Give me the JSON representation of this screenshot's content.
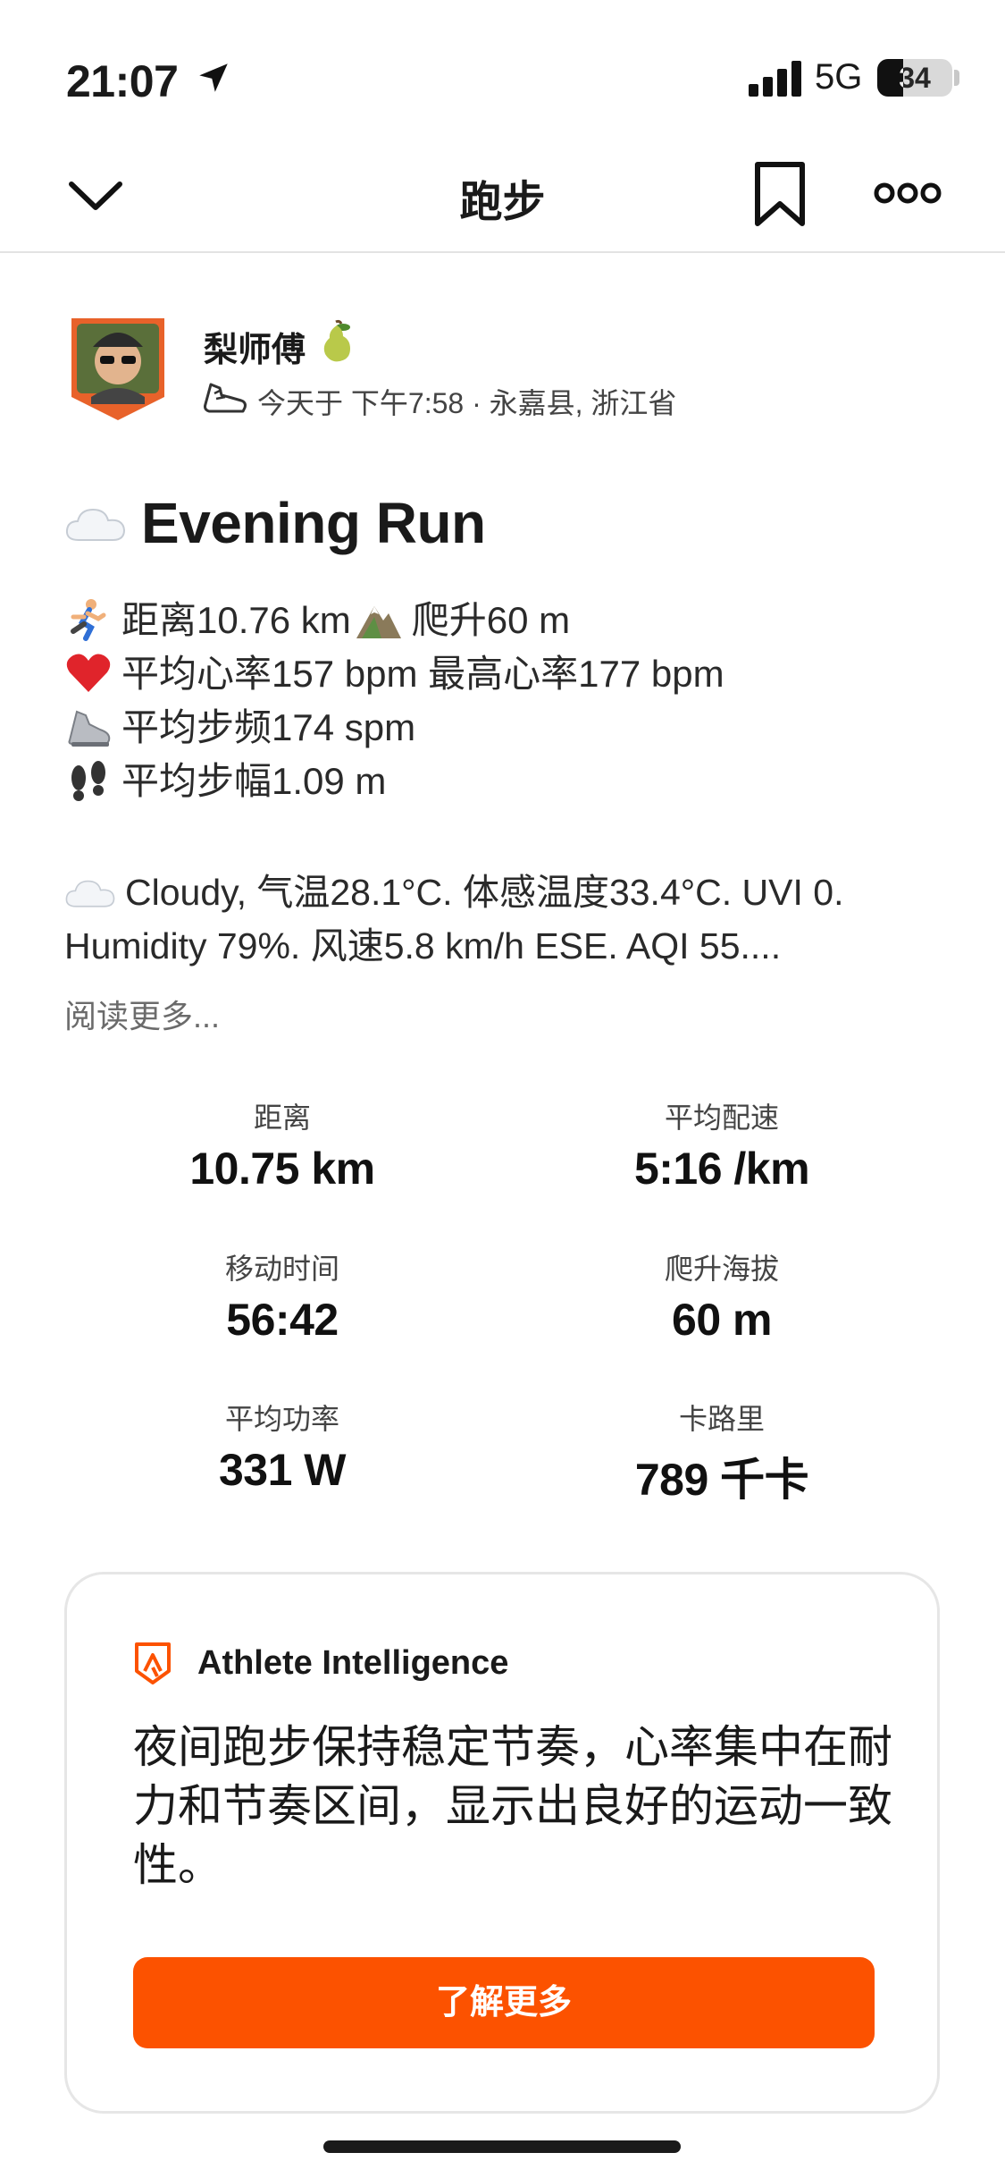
{
  "status_bar": {
    "time": "21:07",
    "network": "5G",
    "battery": "34",
    "battery_fraction": 0.34
  },
  "nav": {
    "title": "跑步"
  },
  "author": {
    "name": "梨师傅",
    "meta": "今天于 下午7:58 · 永嘉县, 浙江省"
  },
  "activity": {
    "title": "Evening Run",
    "lines": [
      {
        "icon": "running-person-icon",
        "text": "距离10.76 km"
      },
      {
        "icon": "mountain-icon",
        "text": "爬升60 m"
      },
      {
        "icon": "heart-icon",
        "text": "平均心率157 bpm 最高心率177 bpm"
      },
      {
        "icon": "sneaker-icon",
        "text": "平均步频174 spm"
      },
      {
        "icon": "footprints-icon",
        "text": "平均步幅1.09 m"
      }
    ],
    "weather": {
      "line1": "Cloudy, 气温28.1°C. 体感温度33.4°C. UVI 0.",
      "line2": "Humidity 79%. 风速5.8 km/h ESE. AQI 55...."
    },
    "read_more": "阅读更多..."
  },
  "stats": [
    {
      "label": "距离",
      "value": "10.75 km"
    },
    {
      "label": "平均配速",
      "value": "5:16 /km"
    },
    {
      "label": "移动时间",
      "value": "56:42"
    },
    {
      "label": "爬升海拔",
      "value": "60 m"
    },
    {
      "label": "平均功率",
      "value": "331 W"
    },
    {
      "label": "卡路里",
      "value": "789 千卡"
    }
  ],
  "ai": {
    "title": "Athlete Intelligence",
    "text": "夜间跑步保持稳定节奏，心率集中在耐力和节奏区间，显示出良好的运动一致性。",
    "button": "了解更多"
  },
  "colors": {
    "brand": "#fc5200",
    "heart": "#e0242b"
  }
}
